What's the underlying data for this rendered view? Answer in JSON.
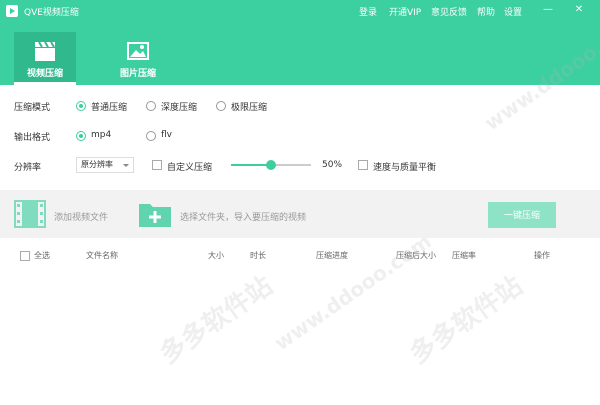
{
  "app": {
    "title": "QVE视频压缩"
  },
  "menu": {
    "login": "登录",
    "vip": "开通VIP",
    "feedback": "意见反馈",
    "help": "帮助",
    "settings": "设置"
  },
  "window_controls": {
    "minimize": "—",
    "close": "✕"
  },
  "tabs": [
    {
      "label": "视频压缩",
      "icon": "clapperboard-icon",
      "active": true
    },
    {
      "label": "图片压缩",
      "icon": "image-icon",
      "active": false
    }
  ],
  "compress_mode": {
    "label": "压缩模式",
    "options": [
      {
        "label": "普通压缩",
        "checked": true
      },
      {
        "label": "深度压缩",
        "checked": false
      },
      {
        "label": "极限压缩",
        "checked": false
      }
    ]
  },
  "output_format": {
    "label": "输出格式",
    "options": [
      {
        "label": "mp4",
        "checked": true
      },
      {
        "label": "flv",
        "checked": false
      }
    ]
  },
  "resolution": {
    "label": "分辨率",
    "selected": "原分辨率",
    "custom_label": "自定义压缩",
    "custom_checked": false,
    "slider_value": 0.5,
    "slider_text": "50%",
    "balance_label": "速度与质量平衡",
    "balance_checked": false
  },
  "actions": {
    "add_video": "添加视频文件",
    "select_folder": "选择文件夹，导入要压缩的视频",
    "compress_all": "一键压缩"
  },
  "list": {
    "select_all": "全选",
    "columns": [
      "文件名称",
      "大小",
      "时长",
      "压缩进度",
      "压缩后大小",
      "压缩率",
      "操作"
    ]
  },
  "watermark": [
    "多多软件站",
    "www.ddooo.com"
  ],
  "colors": {
    "accent": "#3ccfa0",
    "accent_dark": "#2fb98c",
    "button_disabled": "#8ee2c6"
  }
}
